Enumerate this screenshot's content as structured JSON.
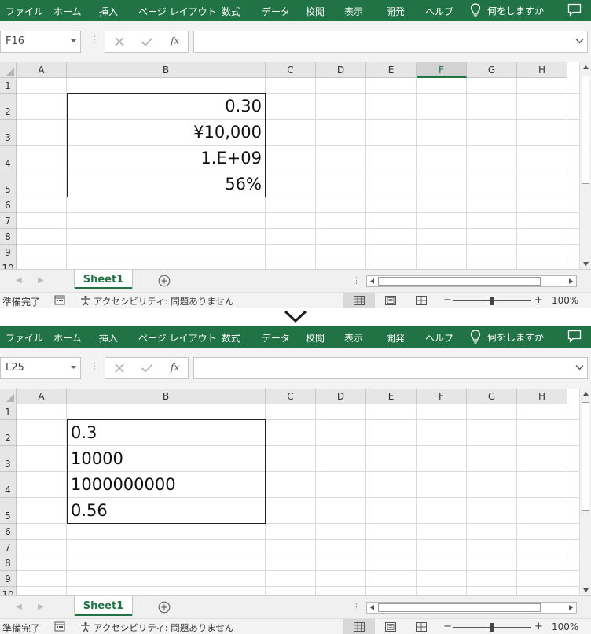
{
  "ribbon_tabs": [
    "ファイル",
    "ホーム",
    "挿入",
    "ページ レイアウト",
    "数式",
    "データ",
    "校閲",
    "表示",
    "開発",
    "ヘルプ"
  ],
  "tell_me": "何をしますか",
  "columns": [
    "A",
    "B",
    "C",
    "D",
    "E",
    "F",
    "G",
    "H"
  ],
  "rows": [
    "1",
    "2",
    "3",
    "4",
    "5",
    "6",
    "7",
    "8",
    "9",
    "10"
  ],
  "sheet_tab": "Sheet1",
  "status": {
    "ready": "準備完了",
    "accessibility": "アクセシビリティ: 問題ありません",
    "zoom_minus": "−",
    "zoom_plus": "+",
    "zoom": "100%",
    "zoom_fraction": 0.5
  },
  "formula_bar": {
    "fx": "fx"
  },
  "colors": {
    "ribbon": "#217346",
    "grid_line": "#dadada",
    "header_bg": "#e6e6e6"
  },
  "icons": {
    "tell_me": "lightbulb-icon",
    "comment": "comment-icon",
    "cancel": "x-icon",
    "enter": "check-icon",
    "add_sheet": "plus-circle-icon",
    "transition": "chevron-down-icon"
  },
  "top": {
    "name_box": "F16",
    "active_column": "F",
    "cell_alignment": "right",
    "cells": [
      "0.30",
      "¥10,000",
      "1.E+09",
      "56%"
    ]
  },
  "bottom": {
    "name_box": "L25",
    "active_column": "",
    "cell_alignment": "left",
    "cells": [
      "0.3",
      "10000",
      "1000000000",
      "0.56"
    ]
  }
}
